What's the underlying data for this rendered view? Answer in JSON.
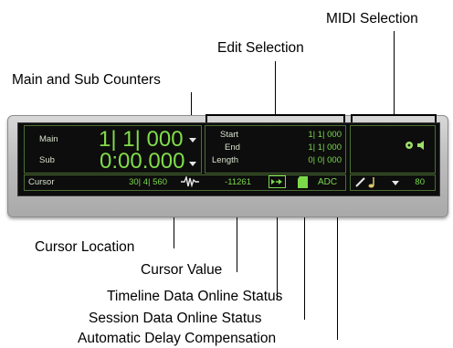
{
  "callouts": {
    "midi_selection": "MIDI Selection",
    "edit_selection": "Edit Selection",
    "main_sub_counters": "Main and Sub Counters",
    "cursor_location": "Cursor Location",
    "cursor_value": "Cursor Value",
    "timeline_status": "Timeline Data Online Status",
    "session_status": "Session Data Online Status",
    "adc": "Automatic Delay Compensation"
  },
  "counters": {
    "main_label": "Main",
    "main_value": "1| 1| 000",
    "sub_label": "Sub",
    "sub_value": "0:00.000"
  },
  "edit_selection": {
    "start_label": "Start",
    "start_value": "1| 1| 000",
    "end_label": "End",
    "end_value": "1| 1| 000",
    "length_label": "Length",
    "length_value": "0| 0| 000"
  },
  "cursor_row": {
    "label": "Cursor",
    "location": "30| 4| 560",
    "value": "-11261",
    "adc": "ADC"
  },
  "midi": {
    "tempo_value": "80"
  },
  "colors": {
    "display_bg": "#0d0d0d",
    "lcd_green": "#7bd84b",
    "panel_border": "#4b6f33"
  }
}
